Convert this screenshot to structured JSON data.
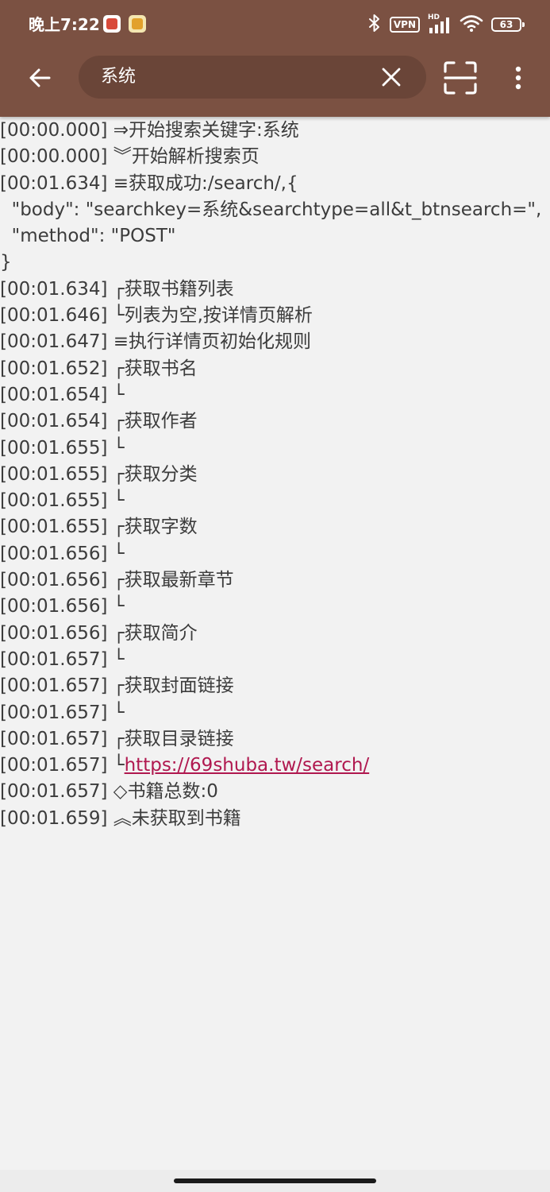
{
  "status_bar": {
    "time": "晚上7:22",
    "vpn_label": "VPN",
    "hd_label": "HD",
    "battery_level": "63"
  },
  "colors": {
    "app_bar": "#7b5142",
    "search_field": "#6a4538",
    "background": "#f2f2f2",
    "log_text": "#3c3c3c",
    "link": "#b0184f"
  },
  "toolbar": {
    "back_icon": "arrow-left-icon",
    "search_query": "系统",
    "clear_icon": "close-icon",
    "scan_icon": "scan-frame-icon",
    "more_icon": "more-vertical-icon"
  },
  "log": [
    {
      "text": "[00:00.000] ⇒开始搜索关键字:系统"
    },
    {
      "text": "[00:00.000] ︾开始解析搜索页"
    },
    {
      "text": "[00:01.634] ≡获取成功:/search/,{"
    },
    {
      "text": "  \"body\": \"searchkey=系统&searchtype=all&t_btnsearch=\","
    },
    {
      "text": "  \"method\": \"POST\""
    },
    {
      "text": "}"
    },
    {
      "text": "[00:01.634] ┌获取书籍列表"
    },
    {
      "text": "[00:01.646] └列表为空,按详情页解析"
    },
    {
      "text": "[00:01.647] ≡执行详情页初始化规则"
    },
    {
      "text": "[00:01.652] ┌获取书名"
    },
    {
      "text": "[00:01.654] └"
    },
    {
      "text": "[00:01.654] ┌获取作者"
    },
    {
      "text": "[00:01.655] └"
    },
    {
      "text": "[00:01.655] ┌获取分类"
    },
    {
      "text": "[00:01.655] └"
    },
    {
      "text": "[00:01.655] ┌获取字数"
    },
    {
      "text": "[00:01.656] └"
    },
    {
      "text": "[00:01.656] ┌获取最新章节"
    },
    {
      "text": "[00:01.656] └"
    },
    {
      "text": "[00:01.656] ┌获取简介"
    },
    {
      "text": "[00:01.657] └"
    },
    {
      "text": "[00:01.657] ┌获取封面链接"
    },
    {
      "text": "[00:01.657] └"
    },
    {
      "text": "[00:01.657] ┌获取目录链接"
    },
    {
      "text": "[00:01.657] └",
      "link": "https://69shuba.tw/search/"
    },
    {
      "text": "[00:01.657] ◇书籍总数:0"
    },
    {
      "text": "[00:01.659] ︽未获取到书籍"
    }
  ]
}
